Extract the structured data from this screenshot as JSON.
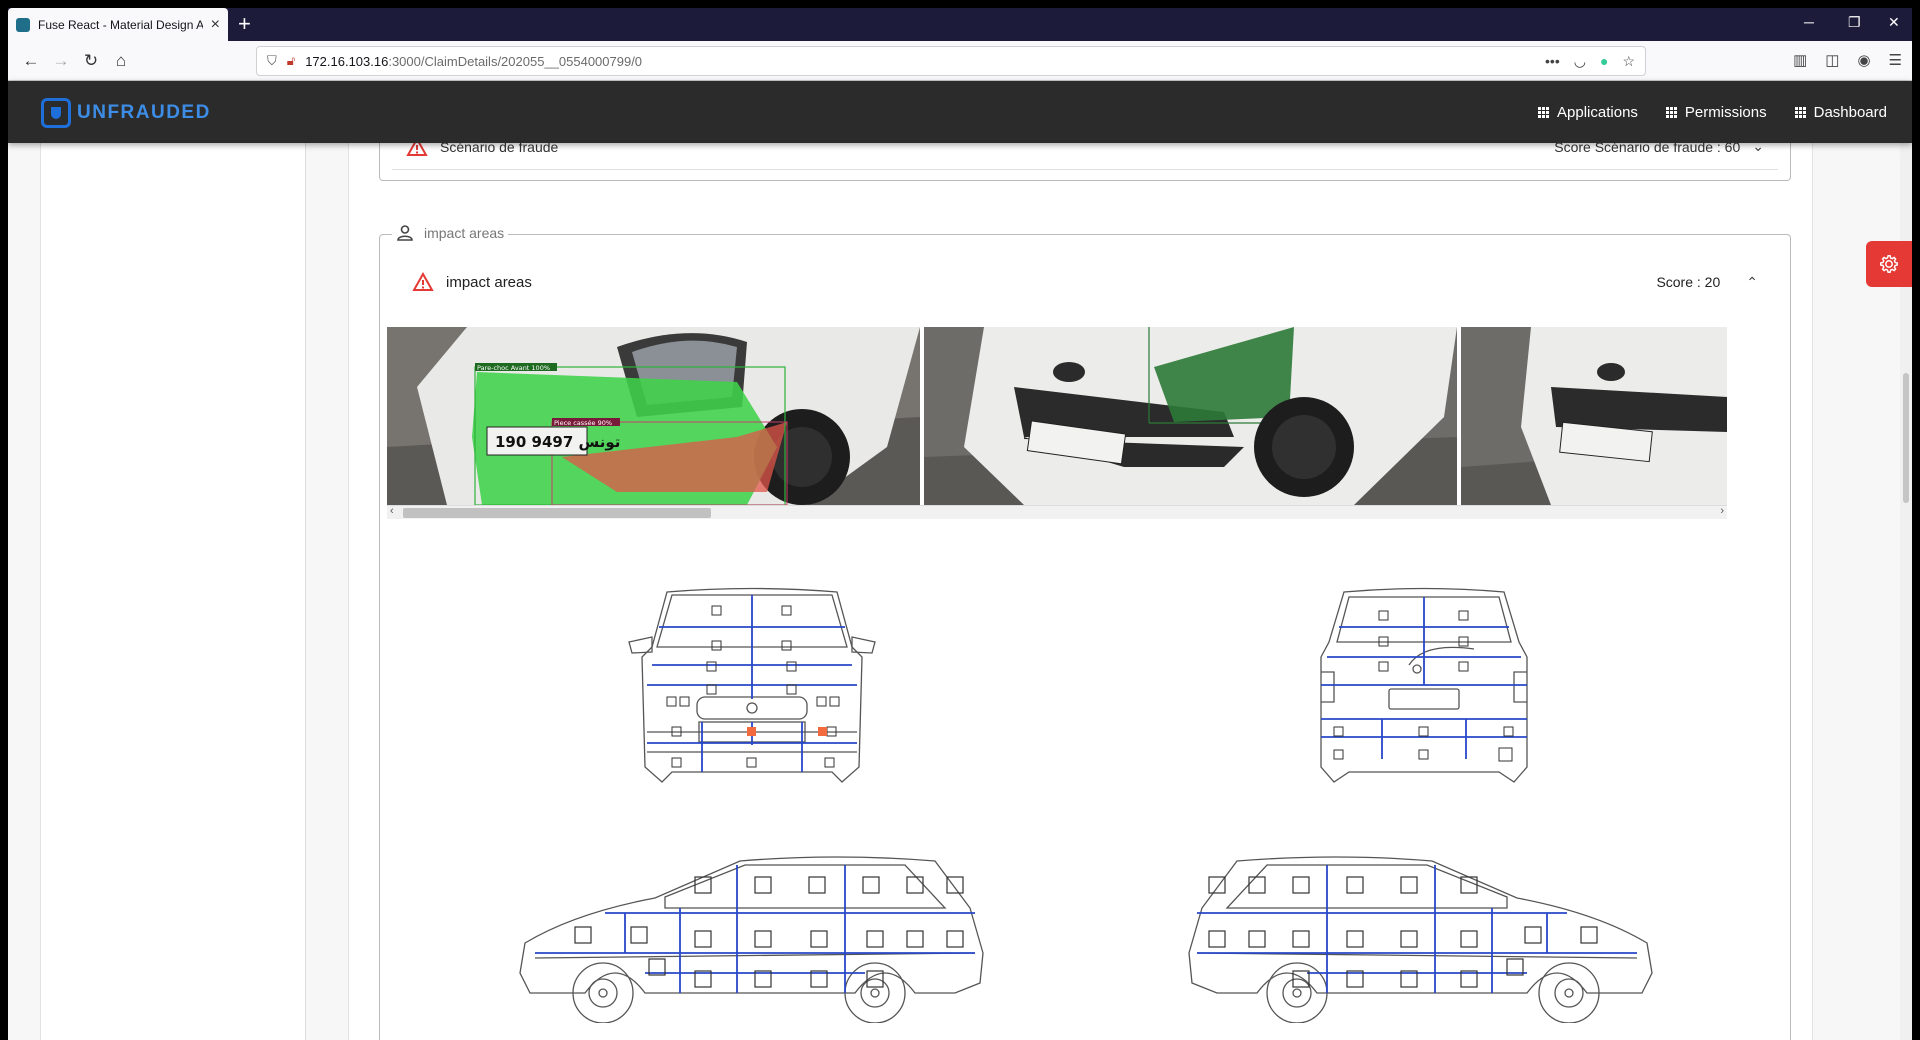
{
  "browser": {
    "tab_title": "Fuse React - Material Design A",
    "url_host": "172.16.103.16",
    "url_path": ":3000/ClaimDetails/202055__0554000799/0",
    "new_tab": "+",
    "tab_close": "×"
  },
  "header": {
    "logo": "UNFRAUDED",
    "nav": [
      {
        "label": "Applications"
      },
      {
        "label": "Permissions"
      },
      {
        "label": "Dashboard"
      }
    ]
  },
  "fraud_panel": {
    "label": "Scénario de fraude",
    "score": "Score Scénario de fraude : 60"
  },
  "impact": {
    "legend": "impact areas",
    "panel_label": "impact areas",
    "score": "Score : 20",
    "photos": [
      {
        "detections": [
          "Pare-choc Avant 100%",
          "Piece cassée 90%"
        ]
      },
      {
        "detections": []
      },
      {
        "detections": []
      }
    ],
    "plate_text": "190 تونس 9497"
  },
  "colors": {
    "accent": "#1e6fd9",
    "alert": "#e53935",
    "damage_green": "#3fd24a",
    "damage_red": "#e0554a",
    "grid_blue": "#2847c8"
  }
}
